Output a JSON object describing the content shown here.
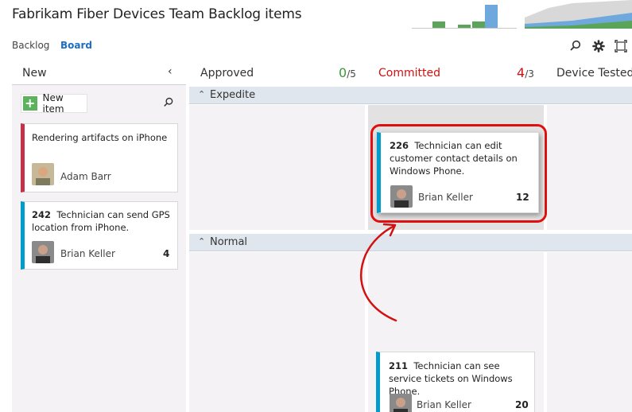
{
  "header": {
    "title": "Fabrikam Fiber Devices Team Backlog items",
    "tabs": [
      {
        "label": "Backlog",
        "active": false
      },
      {
        "label": "Board",
        "active": true
      }
    ],
    "toolbar_icons": [
      "search-icon",
      "gear-icon",
      "fullscreen-icon"
    ],
    "velocity_colors": [
      "#5aa55a",
      "#5aa55a",
      "#5aa55a",
      "#6fa8dc"
    ],
    "cfd_colors": [
      "#d8d8d8",
      "#6fa8dc",
      "#5aa55a"
    ]
  },
  "columns": {
    "new": {
      "label": "New",
      "collapse_icon": "chevron-left-icon"
    },
    "approved": {
      "label": "Approved",
      "count": "0",
      "limit": "/5",
      "count_color": "#3a9a3a"
    },
    "committed": {
      "label": "Committed",
      "count": "4",
      "limit": "/3",
      "label_color": "#d21111",
      "count_color": "#d21111"
    },
    "tested": {
      "label": "Device Tested"
    }
  },
  "new_column": {
    "new_item_label": "New item",
    "search_icon": "search-icon",
    "cards": [
      {
        "title": "Rendering artifacts on iPhone",
        "assignee": "Adam Barr",
        "color": "#c4314b"
      },
      {
        "id": "242",
        "title": "Technician can send GPS location from iPhone.",
        "assignee": "Brian Keller",
        "effort": "4",
        "color": "#009ccc"
      }
    ]
  },
  "swimlanes": [
    {
      "label": "Expedite",
      "chevron": "chevron-up-icon"
    },
    {
      "label": "Normal",
      "chevron": "chevron-up-icon"
    }
  ],
  "board_cards": [
    {
      "id": "226",
      "title": "Technician can edit customer contact details on Windows Phone.",
      "assignee": "Brian Keller",
      "effort": "12",
      "color": "#009ccc",
      "highlight_color": "#e01010"
    },
    {
      "id": "211",
      "title": "Technician can see service tickets on Windows Phone.",
      "assignee": "Brian Keller",
      "effort": "20",
      "color": "#009ccc"
    }
  ],
  "annotation": {
    "arrow_color": "#d21111"
  }
}
